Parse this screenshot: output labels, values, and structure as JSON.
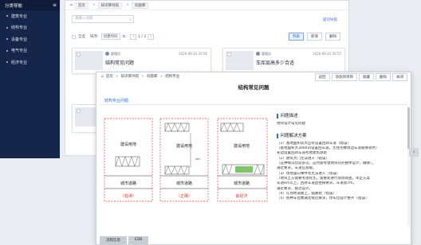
{
  "sidebar": {
    "header": "分类导航",
    "collapse_icon": "list-collapse-icon",
    "items": [
      {
        "label": "建筑专业"
      },
      {
        "label": "结构专业"
      },
      {
        "label": "设备专业"
      },
      {
        "label": "电气专业"
      },
      {
        "label": "经济专业"
      }
    ]
  },
  "bg": {
    "breadcrumb": [
      "首页",
      "知识库导航",
      "问题库"
    ],
    "search_placeholder": "请输入问题",
    "top_link": "提问导航",
    "toolbar": {
      "all": "全选",
      "sort": "排序:",
      "sort_value": "创建时间",
      "page": "1 / 2"
    },
    "buttons": {
      "list": "列表",
      "add": "新增",
      "delete": "删除"
    },
    "cards": [
      {
        "author": "管理员",
        "date": "2020-06-24 20:56",
        "title": "结构常见问题"
      },
      {
        "author": "管理员",
        "date": "2020-06-24 20:55",
        "title": "车库层高多少合适"
      },
      {
        "title": ""
      },
      {
        "title": ""
      }
    ]
  },
  "dialog": {
    "breadcrumb": [
      "首页",
      "知识库导航",
      "问题库",
      "结构专业"
    ],
    "buttons": [
      "返回",
      "添加到项目",
      "收藏",
      "删除",
      "关闭"
    ],
    "title": "结构常见问题",
    "tab": "结构专业问题",
    "figure": {
      "building": "建设用地",
      "road": "城市道路",
      "captions": [
        "（错误）",
        "（正确）",
        "最经济"
      ],
      "dim": "1m"
    },
    "desc_heading": "问题描述",
    "desc_text": "地块设计常见问题",
    "sol_heading": "问题解决方案",
    "sol_lines": [
      "（1）基地面积较大应有设置回转车道（错误）",
      "（基地面积大3000㎡设置回车道，无住宅楼周边车道需要退界）",
      "长边设置回转车道考虑建筑退距",
      "（2）建筑大门无法进入（错误）",
      "（这种情况比较多见，这时需考虑地块内外整体设计，确保），",
      "满足要求，车道应宽敞。",
      "（3）场地竖向事件有无法进入（错误）",
      "（地块土方需要考虑有无，需重新进行现场调查，审定方案",
      "车道6m以上，回转车道直径按要求，车道宽7m，",
      "满足要求，规范设计。",
      "（4）在场地道路上，临路街（错误）",
      "（5）各种车位数满足规范要求，停车位设计整齐（错误）"
    ],
    "footer": [
      "流程信息",
      "EDB"
    ]
  }
}
